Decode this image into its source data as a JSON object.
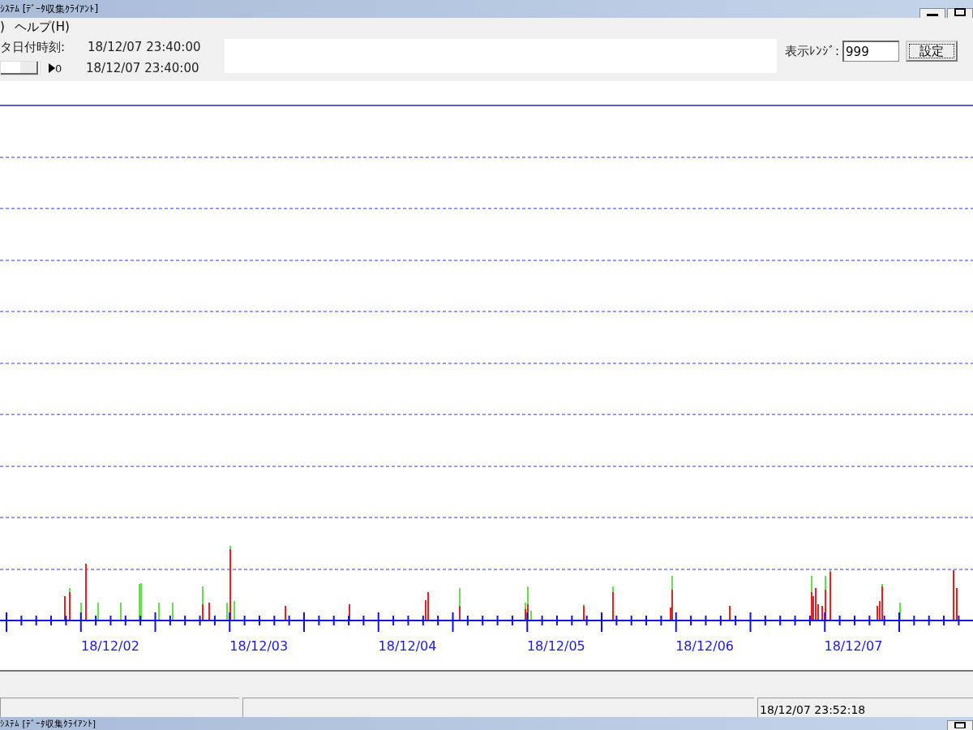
{
  "window": {
    "title": "ｼｽﾃﾑ [ﾃﾞｰﾀ収集ｸﾗｲｱﾝﾄ]"
  },
  "menu": [
    ")",
    "ヘルプ(H)"
  ],
  "toolbar": {
    "date_label": "タ日付時刻:",
    "date_value": "18/12/07 23:40:00",
    "slider": {
      "level": 0.96
    },
    "slider_reading": "0",
    "slider_date": "18/12/07 23:40:00",
    "range_label": "表示ﾚﾝｼﾞ:",
    "range_value": "999",
    "set_button": "設定"
  },
  "chart": {
    "x_labels": [
      "18/12/02",
      "18/12/03",
      "18/12/04",
      "18/12/05",
      "18/12/06",
      "18/12/07"
    ]
  },
  "status_bar": {
    "time": "18/12/07 23:52:18"
  },
  "second_window": {
    "title": "ｼｽﾃﾑ [ﾃﾞｰﾀ収集ｸﾗｲｱﾝﾄ]"
  }
}
